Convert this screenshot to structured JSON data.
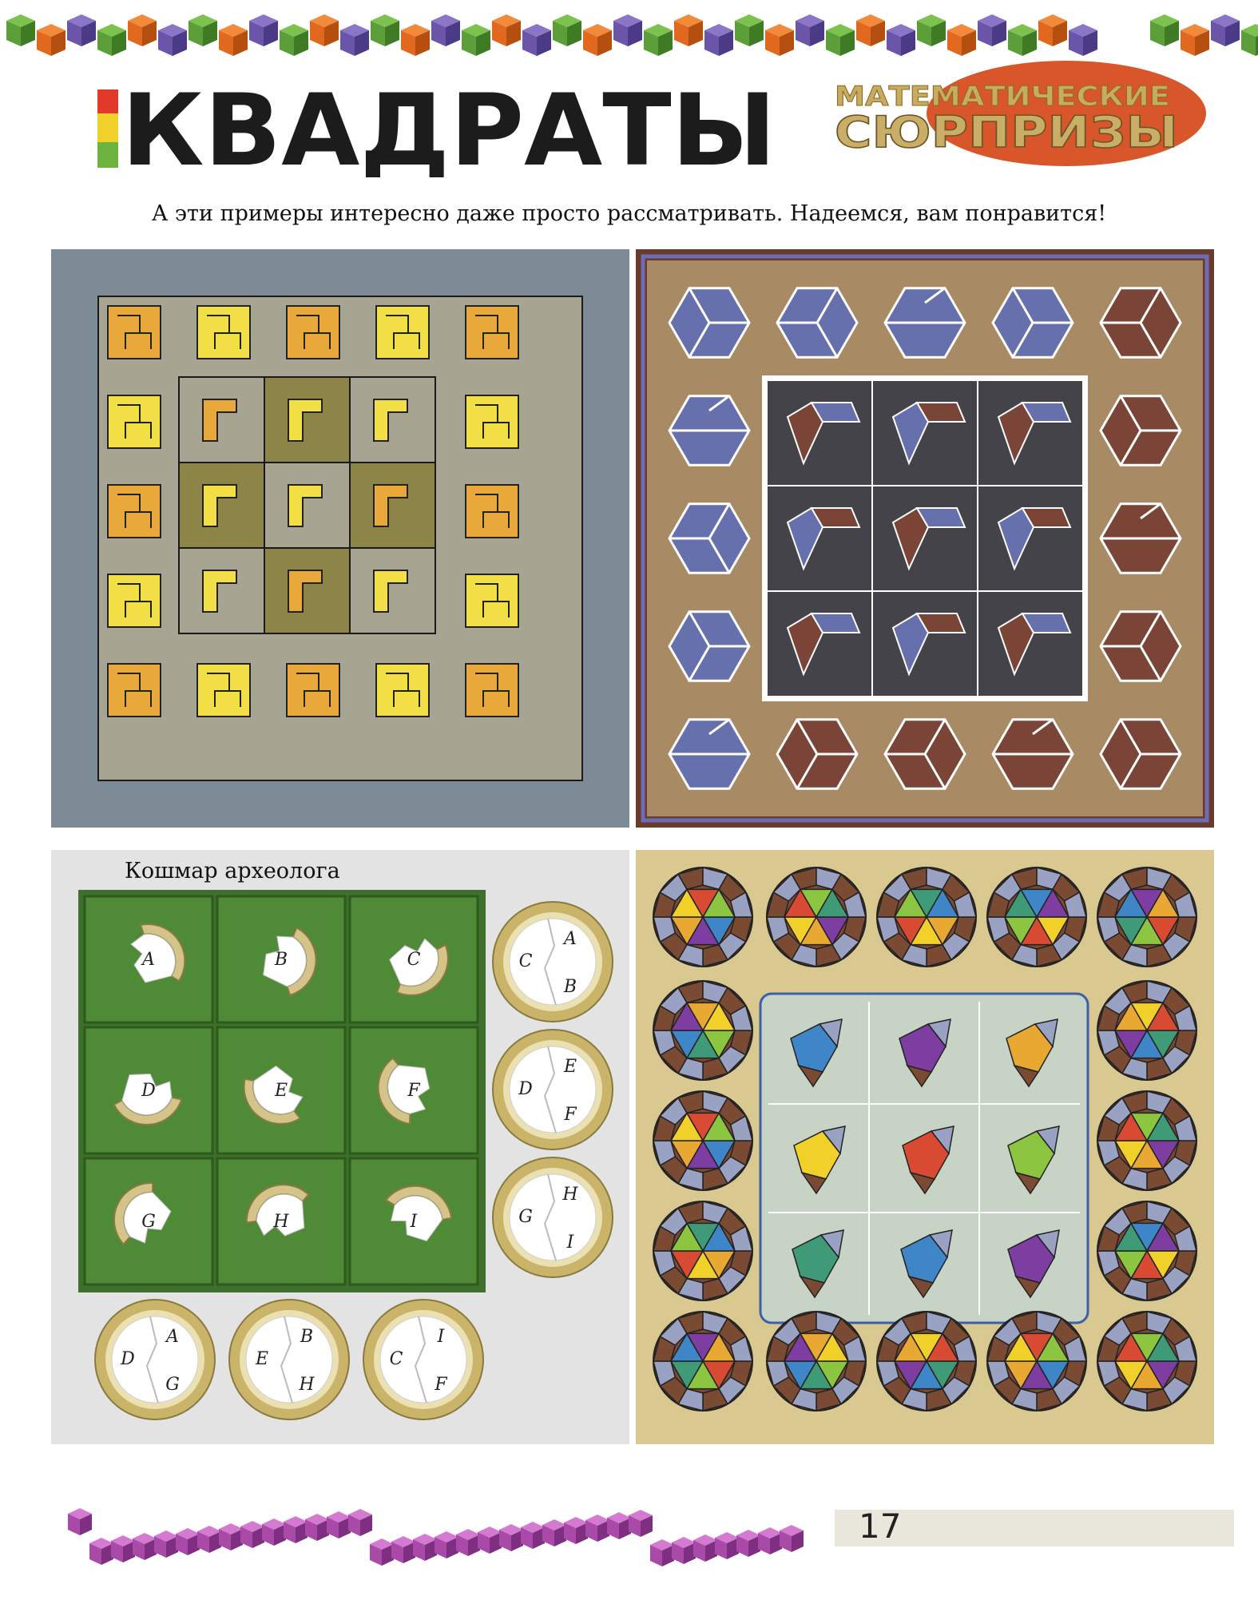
{
  "header": {
    "title": "КВАДРАТЫ",
    "badge_line1": "МАТЕМАТИЧЕСКИЕ",
    "badge_line2": "СЮРПРИЗЫ"
  },
  "subtitle": "А эти примеры интересно даже просто рассматривать. Надеемся, вам понравится!",
  "panel_bl": {
    "caption": "Кошмар археолога",
    "tile_letters": [
      "A",
      "B",
      "C",
      "D",
      "E",
      "F",
      "G",
      "H",
      "I"
    ],
    "ring_labels_right": [
      [
        "C",
        "A",
        "B"
      ],
      [
        "D",
        "E",
        "F"
      ],
      [
        "G",
        "H",
        "I"
      ]
    ],
    "ring_labels_bottom": [
      [
        "D",
        "A",
        "G"
      ],
      [
        "E",
        "B",
        "H"
      ],
      [
        "C",
        "I",
        "F"
      ]
    ]
  },
  "footer": {
    "page_number": "17"
  },
  "colors": {
    "yellow": "#f2df45",
    "orange": "#e8a83a",
    "slate": "#7d8b97",
    "hex_blue": "#6570ad",
    "hex_brown": "#7a4436",
    "panel_brown": "#a88a64",
    "green": "#4a7f34",
    "tan": "#d9c88f"
  }
}
